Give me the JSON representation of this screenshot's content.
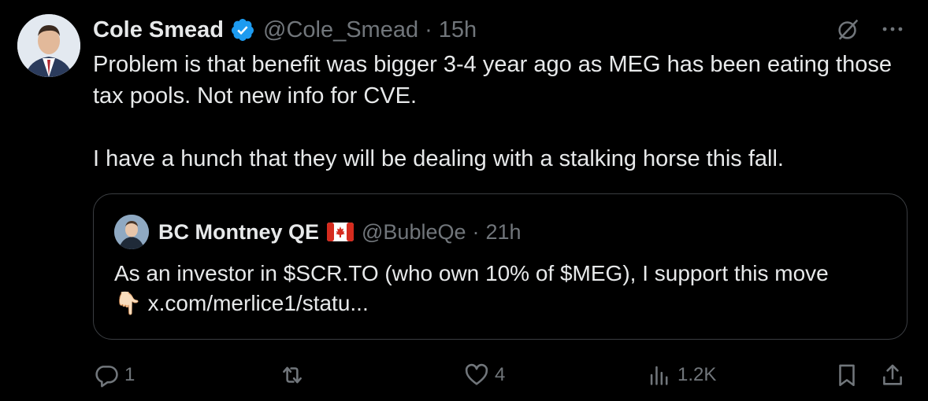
{
  "author": {
    "name": "Cole Smead",
    "handle": "@Cole_Smead",
    "separator": "·",
    "time": "15h"
  },
  "tweet": {
    "paragraphs": [
      "Problem is that benefit was bigger 3-4 year ago as MEG has been eating those tax pools. Not new info for CVE.",
      "I have a hunch that they will be dealing with a stalking horse this fall."
    ]
  },
  "quote": {
    "name": "BC Montney QE",
    "handle": "@BubleQe",
    "separator": "·",
    "time": "21h",
    "line1": "As an investor in $SCR.TO (who own 10% of $MEG), I support this move",
    "line2_emoji": "👇🏻",
    "line2_link": "x.com/merlice1/statu..."
  },
  "actions": {
    "reply_count": "1",
    "like_count": "4",
    "views_count": "1.2K"
  },
  "colors": {
    "background": "#000000",
    "text": "#e7e9ea",
    "muted": "#71767b",
    "verified": "#1d9bf0",
    "border": "#3a3d41"
  }
}
